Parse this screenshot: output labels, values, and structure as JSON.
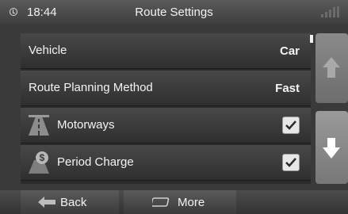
{
  "status_bar": {
    "time": "18:44",
    "title": "Route Settings"
  },
  "settings": [
    {
      "label": "Vehicle",
      "value": "Car"
    },
    {
      "label": "Route Planning Method",
      "value": "Fast"
    },
    {
      "label": "Motorways",
      "checked": true,
      "icon": "motorway-icon"
    },
    {
      "label": "Period Charge",
      "checked": true,
      "icon": "toll-charge-icon"
    }
  ],
  "bottom_bar": {
    "back_label": "Back",
    "more_label": "More"
  },
  "colors": {
    "panel": "#3a3a3a",
    "row": "#3c3c3c",
    "text": "#f4f4f4",
    "checkbox": "#e8e8e8"
  }
}
